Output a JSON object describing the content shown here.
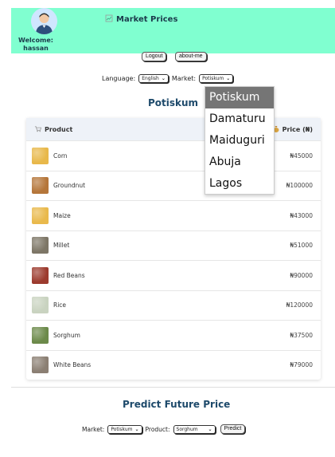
{
  "header": {
    "title": "Market Prices",
    "title_icon": "chart-icon",
    "welcome_label": "Welcome:",
    "username": "hassan",
    "background": "#80ffd0"
  },
  "buttons": {
    "logout": "Logout",
    "about": "about-me",
    "predict": "Predict"
  },
  "filters": {
    "language_label": "Language:",
    "language_value": "English",
    "market_label": "Market:",
    "market_value": "Potiskum"
  },
  "market_title": "Potiskum",
  "table": {
    "product_header": "Product",
    "price_header": "Price (₦)",
    "rows": [
      {
        "name": "Corn",
        "price": "₦45000",
        "color": "#e8b84a"
      },
      {
        "name": "Groundnut",
        "price": "₦100000",
        "color": "#b5763a"
      },
      {
        "name": "Maize",
        "price": "₦43000",
        "color": "#e9b94c"
      },
      {
        "name": "Millet",
        "price": "₦51000",
        "color": "#7d7666"
      },
      {
        "name": "Red Beans",
        "price": "₦90000",
        "color": "#9c3b2e"
      },
      {
        "name": "Rice",
        "price": "₦120000",
        "color": "#c9d3c0"
      },
      {
        "name": "Sorghum",
        "price": "₦37500",
        "color": "#6c8a4a"
      },
      {
        "name": "White Beans",
        "price": "₦79000",
        "color": "#8b7f73"
      }
    ]
  },
  "dropdown": {
    "options": [
      "Potiskum",
      "Damaturu",
      "Maiduguri",
      "Abuja",
      "Lagos"
    ],
    "selected": "Potiskum"
  },
  "predict": {
    "title": "Predict Future Price",
    "market_label": "Market:",
    "market_value": "Potiskum",
    "product_label": "Product:",
    "product_value": "Sorghum"
  }
}
